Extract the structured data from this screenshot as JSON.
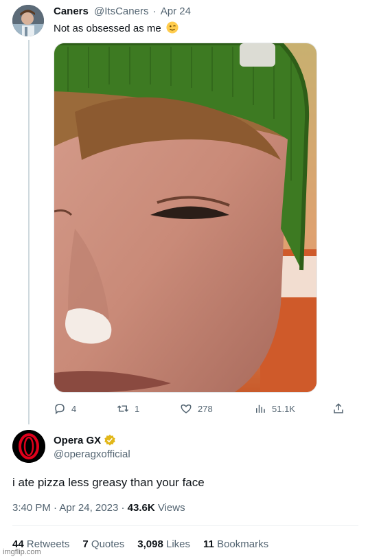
{
  "tweet": {
    "author_name": "Caners",
    "author_handle": "@ItsCaners",
    "separator": "·",
    "date": "Apr 24",
    "text": "Not as obsessed as me",
    "emoji": "winking-face-emoji",
    "actions": {
      "reply_count": "4",
      "retweet_count": "1",
      "like_count": "278",
      "view_count": "51.1K"
    }
  },
  "reply": {
    "author_name": "Opera GX",
    "author_handle": "@operagxofficial",
    "verified_badge": "gold-verified-icon",
    "text": "i ate pizza less greasy than your face",
    "time": "3:40 PM",
    "date": "Apr 24, 2023",
    "view_count": "43.6K",
    "view_label": "Views",
    "stats": {
      "retweets_count": "44",
      "retweets_label": "Retweets",
      "quotes_count": "7",
      "quotes_label": "Quotes",
      "likes_count": "3,098",
      "likes_label": "Likes",
      "bookmarks_count": "11",
      "bookmarks_label": "Bookmarks"
    }
  },
  "watermark": "imgflip.com",
  "colors": {
    "text_primary": "#0f1419",
    "text_secondary": "#536471",
    "opera_red": "#e0001b",
    "verified_gold": "#e2b719"
  }
}
